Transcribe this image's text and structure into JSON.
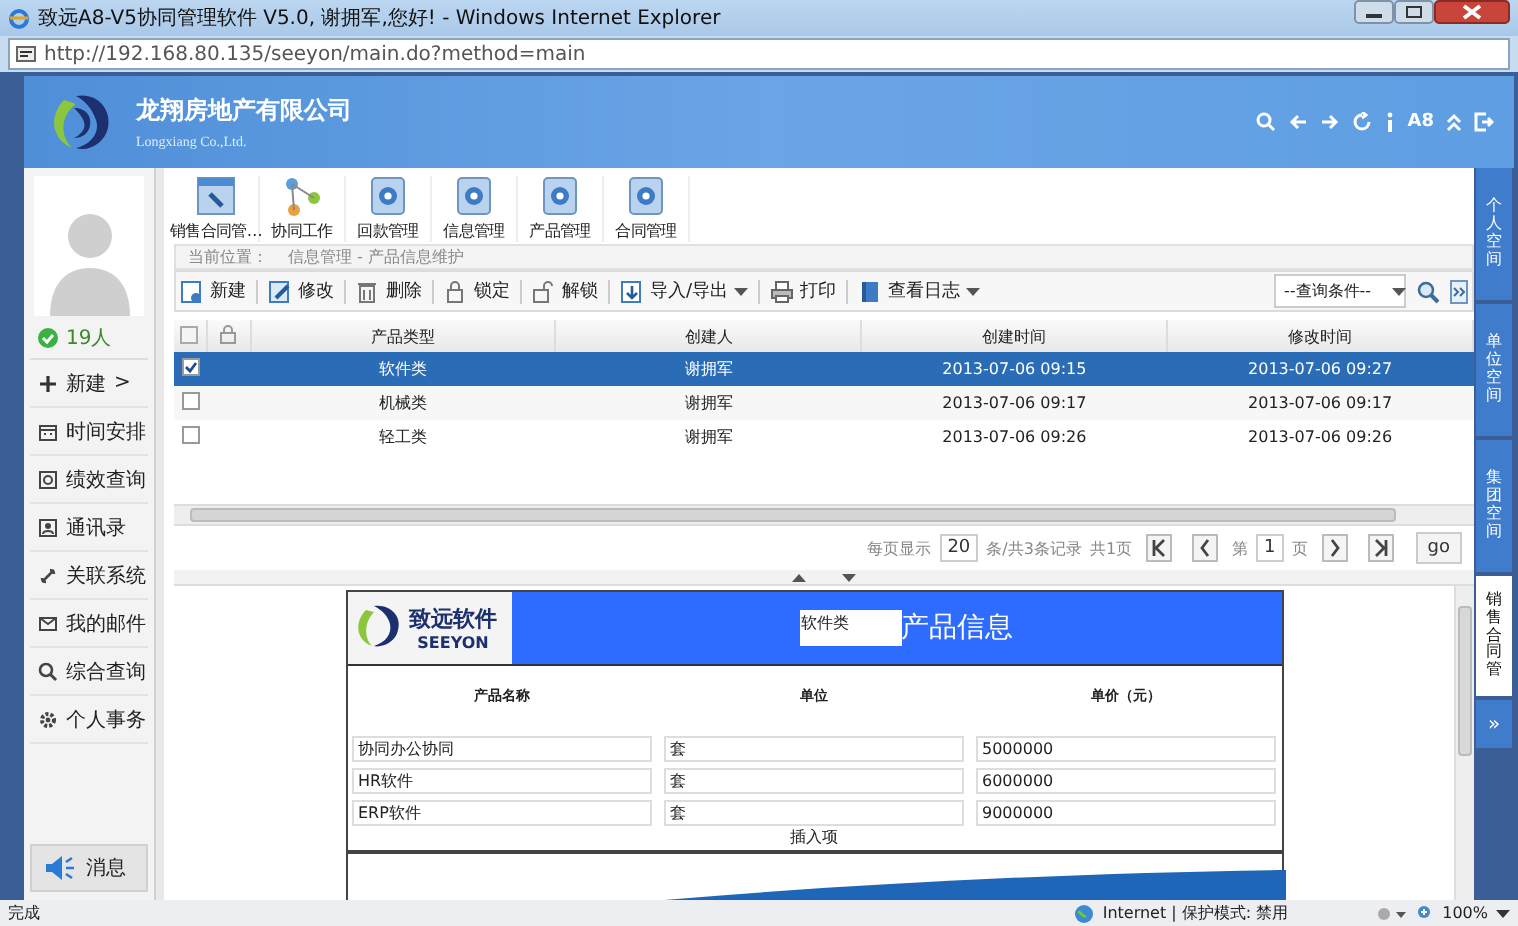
{
  "window": {
    "title": "致远A8-V5协同管理软件 V5.0, 谢拥军,您好! - Windows Internet Explorer",
    "address": "http://192.168.80.135/seeyon/main.do?method=main"
  },
  "header": {
    "company": "龙翔房地产有限公司",
    "company_en": "Longxiang Co.,Ltd.",
    "font_tool": "A8"
  },
  "sidebar": {
    "online_count": "19人",
    "items": [
      {
        "label": "新建",
        "arrow": ">"
      },
      {
        "label": "时间安排"
      },
      {
        "label": "绩效查询"
      },
      {
        "label": "通讯录"
      },
      {
        "label": "关联系统"
      },
      {
        "label": "我的邮件"
      },
      {
        "label": "综合查询"
      },
      {
        "label": "个人事务"
      }
    ],
    "message_button": "消息"
  },
  "apps": [
    {
      "label": "销售合同管…"
    },
    {
      "label": "协同工作"
    },
    {
      "label": "回款管理"
    },
    {
      "label": "信息管理"
    },
    {
      "label": "产品管理"
    },
    {
      "label": "合同管理"
    }
  ],
  "breadcrumb": {
    "prefix": "当前位置：",
    "path": "信息管理 - 产品信息维护"
  },
  "toolbar": {
    "items": [
      {
        "label": "新建",
        "dropdown": false
      },
      {
        "label": "修改",
        "dropdown": false
      },
      {
        "label": "删除",
        "dropdown": false
      },
      {
        "label": "锁定",
        "dropdown": false
      },
      {
        "label": "解锁",
        "dropdown": false
      },
      {
        "label": "导入/导出",
        "dropdown": true
      },
      {
        "label": "打印",
        "dropdown": false
      },
      {
        "label": "查看日志",
        "dropdown": true
      }
    ],
    "query_select": "--查询条件--"
  },
  "table": {
    "all_checked": false,
    "columns": [
      "产品类型",
      "创建人",
      "创建时间",
      "修改时间"
    ],
    "rows": [
      {
        "selected": true,
        "checked": true,
        "cells": [
          "软件类",
          "谢拥军",
          "2013-07-06 09:15",
          "2013-07-06 09:27"
        ]
      },
      {
        "selected": false,
        "checked": false,
        "cells": [
          "机械类",
          "谢拥军",
          "2013-07-06 09:17",
          "2013-07-06 09:17"
        ]
      },
      {
        "selected": false,
        "checked": false,
        "cells": [
          "轻工类",
          "谢拥军",
          "2013-07-06 09:26",
          "2013-07-06 09:26"
        ]
      }
    ]
  },
  "pager": {
    "per_page_label": "每页显示",
    "per_page": "20",
    "summary": "条/共3条记录",
    "pages": "共1页",
    "page_prefix": "第",
    "page": "1",
    "page_suffix": "页",
    "go": "go"
  },
  "form": {
    "logo_cn": "致远软件",
    "logo_en": "SEEYON",
    "type_value": "软件类",
    "title": "产品信息",
    "columns": [
      "产品名称",
      "单位",
      "单价（元）"
    ],
    "rows": [
      [
        "协同办公协同",
        "套",
        "5000000"
      ],
      [
        "HR软件",
        "套",
        "6000000"
      ],
      [
        "ERP软件",
        "套",
        "9000000"
      ]
    ],
    "insert": "插入项"
  },
  "right_tabs": [
    {
      "label": "个人空间",
      "selected": false
    },
    {
      "label": "单位空间",
      "selected": false
    },
    {
      "label": "集团空间",
      "selected": false
    },
    {
      "label": "销售合同管",
      "selected": true
    }
  ],
  "right_expand": "»",
  "status_bar": {
    "text": "完成",
    "zone": "Internet | 保护模式: 禁用",
    "zoom": "100%"
  }
}
